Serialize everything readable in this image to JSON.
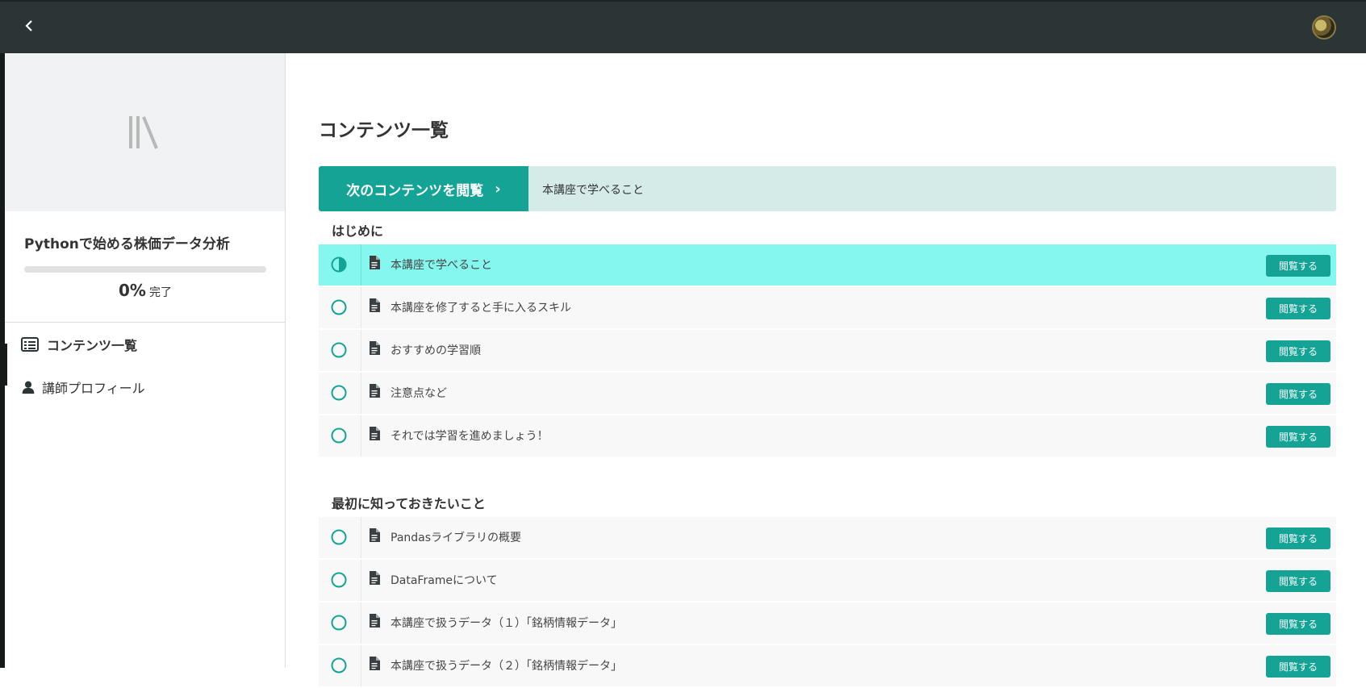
{
  "colors": {
    "accent": "#15a396",
    "current_row": "#86f7ee",
    "next_bar_bg": "#d5ebe8",
    "topbar": "#2b3536"
  },
  "topbar": {
    "back_icon": "chevron-left-icon",
    "avatar": "user-avatar"
  },
  "sidebar": {
    "course_title": "Pythonで始める株価データ分析",
    "progress_fraction": 0,
    "progress_percent": "0%",
    "progress_suffix": "完了",
    "nav": [
      {
        "label": "コンテンツ一覧",
        "icon": "list-icon",
        "active": true
      },
      {
        "label": "講師プロフィール",
        "icon": "user-icon",
        "active": false
      }
    ]
  },
  "main": {
    "page_title": "コンテンツ一覧",
    "next_button_label": "次のコンテンツを閲覧",
    "next_button_arrow": "›",
    "next_content_title": "本講座で学べること",
    "view_button_label": "閲覧する",
    "sections": [
      {
        "title": "はじめに",
        "items": [
          {
            "title": "本講座で学べること",
            "status": "in-progress"
          },
          {
            "title": "本講座を修了すると手に入るスキル",
            "status": "not-started"
          },
          {
            "title": "おすすめの学習順",
            "status": "not-started"
          },
          {
            "title": "注意点など",
            "status": "not-started"
          },
          {
            "title": "それでは学習を進めましょう！",
            "status": "not-started"
          }
        ]
      },
      {
        "title": "最初に知っておきたいこと",
        "items": [
          {
            "title": "Pandasライブラリの概要",
            "status": "not-started"
          },
          {
            "title": "DataFrameについて",
            "status": "not-started"
          },
          {
            "title": "本講座で扱うデータ（１）「銘柄情報データ」",
            "status": "not-started"
          },
          {
            "title": "本講座で扱うデータ（２）「銘柄情報データ」",
            "status": "not-started"
          }
        ]
      }
    ]
  }
}
